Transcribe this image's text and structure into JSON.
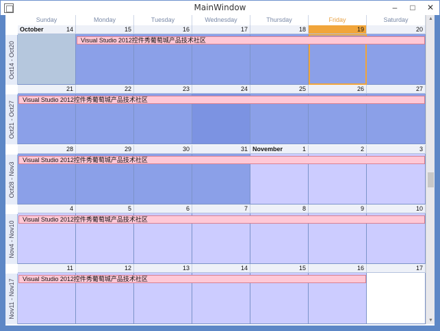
{
  "window": {
    "title": "MainWindow"
  },
  "days": [
    "Sunday",
    "Monday",
    "Tuesday",
    "Wednesday",
    "Thursday",
    "Friday",
    "Saturday"
  ],
  "weeks": [
    {
      "label": "Oct14 - Oct20",
      "dates": [
        "14",
        "15",
        "16",
        "17",
        "18",
        "19",
        "20"
      ],
      "month_first": "October"
    },
    {
      "label": "Oct21 - Oct27",
      "dates": [
        "21",
        "22",
        "23",
        "24",
        "25",
        "26",
        "27"
      ]
    },
    {
      "label": "Oct28 - Nov3",
      "dates": [
        "28",
        "29",
        "30",
        "31",
        "1",
        "2",
        "3"
      ],
      "month_mid": "November"
    },
    {
      "label": "Nov4 - Nov10",
      "dates": [
        "4",
        "5",
        "6",
        "7",
        "8",
        "9",
        "10"
      ]
    },
    {
      "label": "Nov11 - Nov17",
      "dates": [
        "11",
        "12",
        "13",
        "14",
        "15",
        "16",
        "17"
      ]
    }
  ],
  "appointment": {
    "text": "Visual Studio 2012控件秀葡萄城产品技术社区",
    "color": "#ffc8d6"
  },
  "colors": {
    "current_month": "#8ba0e8",
    "other_month": "#ccccff",
    "today": "#f1a53a"
  }
}
